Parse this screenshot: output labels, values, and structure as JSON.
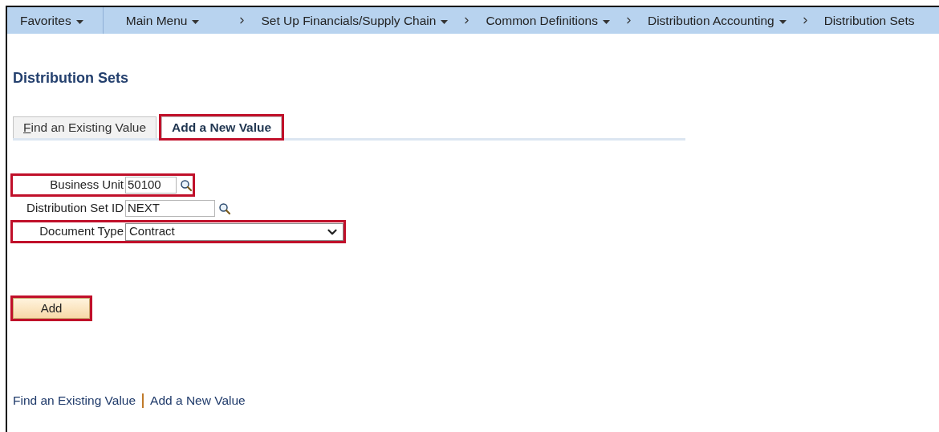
{
  "nav_bar": {
    "items": [
      {
        "label": "Favorites",
        "kind": "menu",
        "separator_before": false
      },
      {
        "label": "Main Menu",
        "kind": "menu",
        "separator_before": false
      },
      {
        "label": "Set Up Financials/Supply Chain",
        "kind": "menu",
        "separator_before": true
      },
      {
        "label": "Common Definitions",
        "kind": "menu",
        "separator_before": true
      },
      {
        "label": "Distribution Accounting",
        "kind": "menu",
        "separator_before": true
      },
      {
        "label": "Distribution Sets",
        "kind": "current",
        "separator_before": true
      }
    ]
  },
  "page_title": "Distribution Sets",
  "tabs": [
    {
      "label": "Find an Existing Value",
      "selected": false,
      "highlighted": false
    },
    {
      "label": "Add a New Value",
      "selected": true,
      "highlighted": true
    }
  ],
  "fields": [
    {
      "label": "Business Unit",
      "value": "50100",
      "kind": "lookup",
      "highlighted": true
    },
    {
      "label": "Distribution Set ID",
      "value": "NEXT",
      "kind": "lookup",
      "highlighted": false
    },
    {
      "label": "Document Type",
      "value": "Contract",
      "kind": "dropdown",
      "highlighted": true
    }
  ],
  "add_button": {
    "label": "Add",
    "highlighted": true
  },
  "footer_links": [
    "Find an Existing Value",
    "Add a New Value"
  ]
}
